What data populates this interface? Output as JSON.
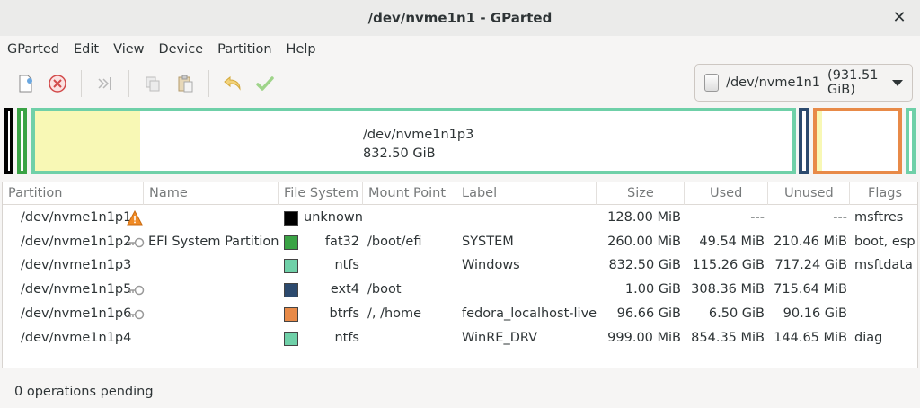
{
  "window": {
    "title": "/dev/nvme1n1 - GParted",
    "close_icon": "close-icon"
  },
  "menu": [
    "GParted",
    "Edit",
    "View",
    "Device",
    "Partition",
    "Help"
  ],
  "toolbar": {
    "icons": [
      "new-icon",
      "delete-icon",
      "resize-move-icon",
      "copy-icon",
      "paste-icon",
      "undo-icon",
      "apply-icon"
    ]
  },
  "device_selector": {
    "device": "/dev/nvme1n1",
    "size": "(931.51 GiB)"
  },
  "disk_map": {
    "selected_name": "/dev/nvme1n1p3",
    "selected_size": "832.50 GiB"
  },
  "columns": [
    "Partition",
    "Name",
    "File System",
    "Mount Point",
    "Label",
    "Size",
    "Used",
    "Unused",
    "Flags"
  ],
  "partitions": [
    {
      "partition": "/dev/nvme1n1p1",
      "name": "",
      "fs": "unknown",
      "fs_color": "#000000",
      "mount": "",
      "label": "",
      "size": "128.00 MiB",
      "used": "---",
      "unused": "---",
      "flags": "msftres",
      "warning": true,
      "locked": false
    },
    {
      "partition": "/dev/nvme1n1p2",
      "name": "EFI System Partition",
      "fs": "fat32",
      "fs_color": "#3aa345",
      "mount": "/boot/efi",
      "label": "SYSTEM",
      "size": "260.00 MiB",
      "used": "49.54 MiB",
      "unused": "210.46 MiB",
      "flags": "boot, esp",
      "warning": false,
      "locked": true
    },
    {
      "partition": "/dev/nvme1n1p3",
      "name": "",
      "fs": "ntfs",
      "fs_color": "#6fd0a8",
      "mount": "",
      "label": "Windows",
      "size": "832.50 GiB",
      "used": "115.26 GiB",
      "unused": "717.24 GiB",
      "flags": "msftdata",
      "warning": false,
      "locked": false
    },
    {
      "partition": "/dev/nvme1n1p5",
      "name": "",
      "fs": "ext4",
      "fs_color": "#2c4a6e",
      "mount": "/boot",
      "label": "",
      "size": "1.00 GiB",
      "used": "308.36 MiB",
      "unused": "715.64 MiB",
      "flags": "",
      "warning": false,
      "locked": true
    },
    {
      "partition": "/dev/nvme1n1p6",
      "name": "",
      "fs": "btrfs",
      "fs_color": "#e88a48",
      "mount": "/, /home",
      "label": "fedora_localhost-live",
      "size": "96.66 GiB",
      "used": "6.50 GiB",
      "unused": "90.16 GiB",
      "flags": "",
      "warning": false,
      "locked": true
    },
    {
      "partition": "/dev/nvme1n1p4",
      "name": "",
      "fs": "ntfs",
      "fs_color": "#6fd0a8",
      "mount": "",
      "label": "WinRE_DRV",
      "size": "999.00 MiB",
      "used": "854.35 MiB",
      "unused": "144.65 MiB",
      "flags": "diag",
      "warning": false,
      "locked": false
    }
  ],
  "status": "0 operations pending"
}
